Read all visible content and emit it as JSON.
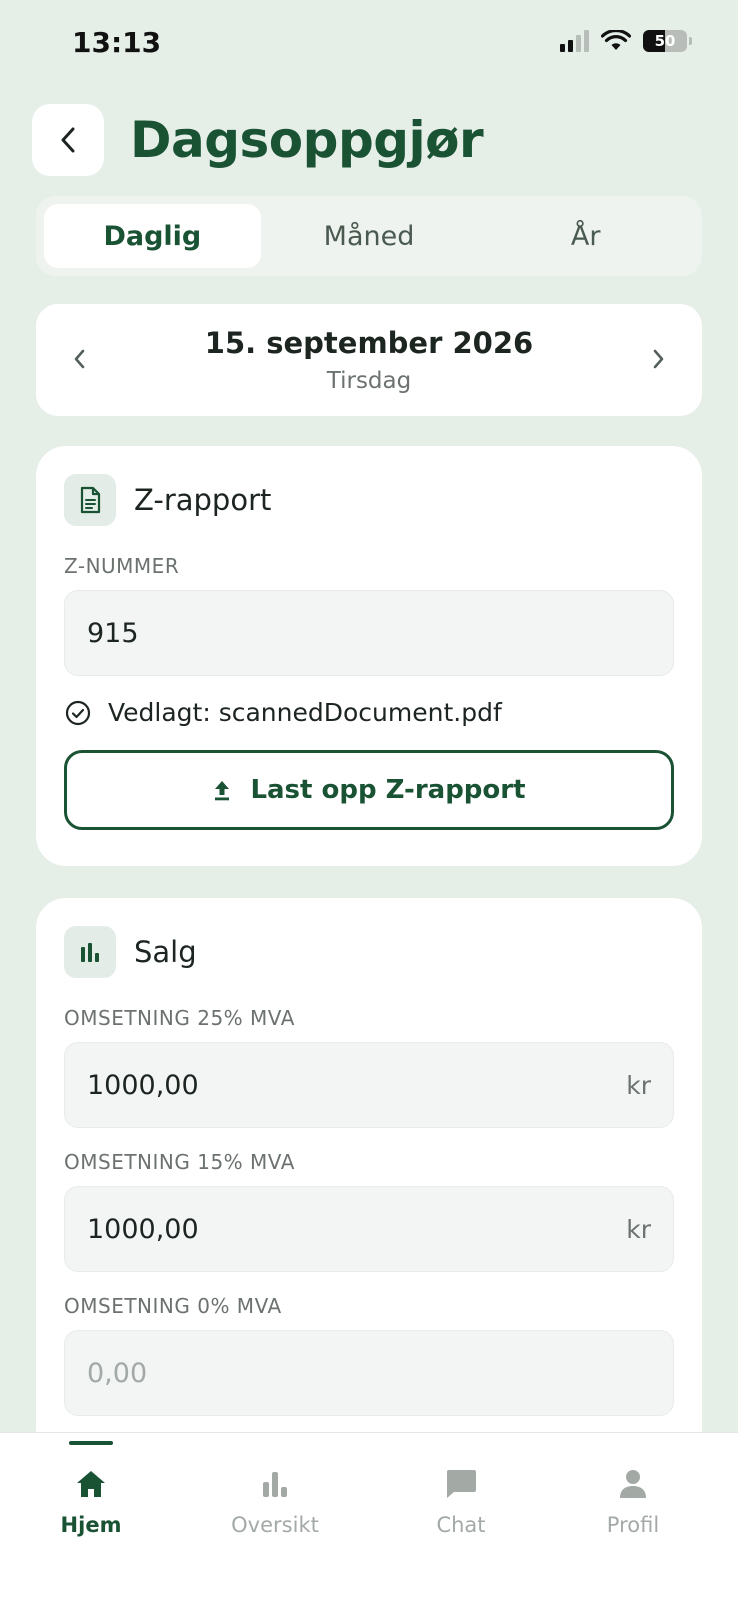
{
  "status_bar": {
    "time": "13:13",
    "battery": "50",
    "battery_level": 0.5
  },
  "header": {
    "title": "Dagsoppgjør"
  },
  "period_tabs": [
    {
      "label": "Daglig",
      "active": true
    },
    {
      "label": "Måned",
      "active": false
    },
    {
      "label": "År",
      "active": false
    }
  ],
  "date": {
    "main": "15. september 2026",
    "weekday": "Tirsdag"
  },
  "z_report": {
    "title": "Z-rapport",
    "number_label": "Z-NUMMER",
    "number_value": "915",
    "attached_text": "Vedlagt: scannedDocument.pdf",
    "upload_label": "Last opp Z-rapport"
  },
  "sales": {
    "title": "Salg",
    "fields": [
      {
        "label": "OMSETNING 25% MVA",
        "value": "1000,00",
        "unit": "kr"
      },
      {
        "label": "OMSETNING 15% MVA",
        "value": "1000,00",
        "unit": "kr"
      },
      {
        "label": "OMSETNING 0% MVA",
        "placeholder": "0,00"
      }
    ]
  },
  "tabbar": {
    "items": [
      {
        "label": "Hjem",
        "icon": "home-icon",
        "active": true
      },
      {
        "label": "Oversikt",
        "icon": "bar-chart-icon",
        "active": false
      },
      {
        "label": "Chat",
        "icon": "chat-icon",
        "active": false
      },
      {
        "label": "Profil",
        "icon": "person-icon",
        "active": false
      }
    ]
  },
  "colors": {
    "background": "#e6eee8",
    "accent": "#1a5234",
    "card": "#ffffff",
    "muted": "#a3aaa6"
  }
}
